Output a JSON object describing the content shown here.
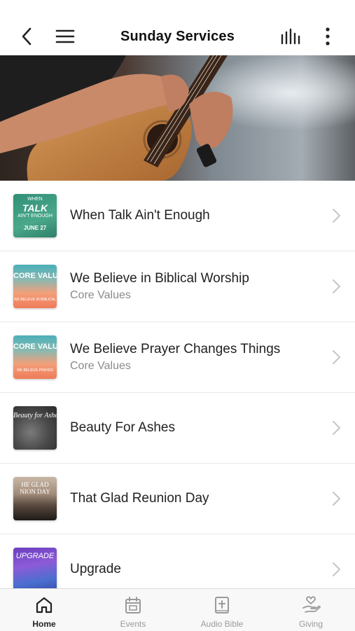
{
  "header": {
    "title": "Sunday Services",
    "back_icon": "back-icon",
    "menu_icon": "menu-icon",
    "audio_icon": "audio-bars-icon",
    "more_icon": "more-vertical-icon"
  },
  "hero": {
    "image": "guitar-player-photo"
  },
  "items": [
    {
      "title": "When Talk Ain't Enough",
      "subtitle": "",
      "thumb_lines": [
        "WHEN",
        "TALK",
        "AIN'T ENOUGH",
        "JUNE 27"
      ]
    },
    {
      "title": "We Believe in Biblical Worship",
      "subtitle": "Core Values",
      "thumb_lines": [
        "CORE VALUES",
        "WE BELIEVE IN BIBLICAL"
      ]
    },
    {
      "title": "We Believe Prayer Changes Things",
      "subtitle": "Core Values",
      "thumb_lines": [
        "CORE VALUES",
        "WE BELIEVE PRAYER"
      ]
    },
    {
      "title": "Beauty For Ashes",
      "subtitle": "",
      "thumb_lines": [
        "Beauty for Ashes"
      ]
    },
    {
      "title": "That Glad Reunion Day",
      "subtitle": "",
      "thumb_lines": [
        "HE GLAD",
        "NION DAY"
      ]
    },
    {
      "title": "Upgrade",
      "subtitle": "",
      "thumb_lines": [
        "UPGRADE"
      ]
    }
  ],
  "tabs": [
    {
      "label": "Home",
      "icon": "home-icon",
      "active": true
    },
    {
      "label": "Events",
      "icon": "calendar-icon",
      "active": false
    },
    {
      "label": "Audio Bible",
      "icon": "bible-icon",
      "active": false
    },
    {
      "label": "Giving",
      "icon": "giving-hand-icon",
      "active": false
    }
  ],
  "colors": {
    "accent": "#222222",
    "inactive": "#9a9a9a"
  }
}
